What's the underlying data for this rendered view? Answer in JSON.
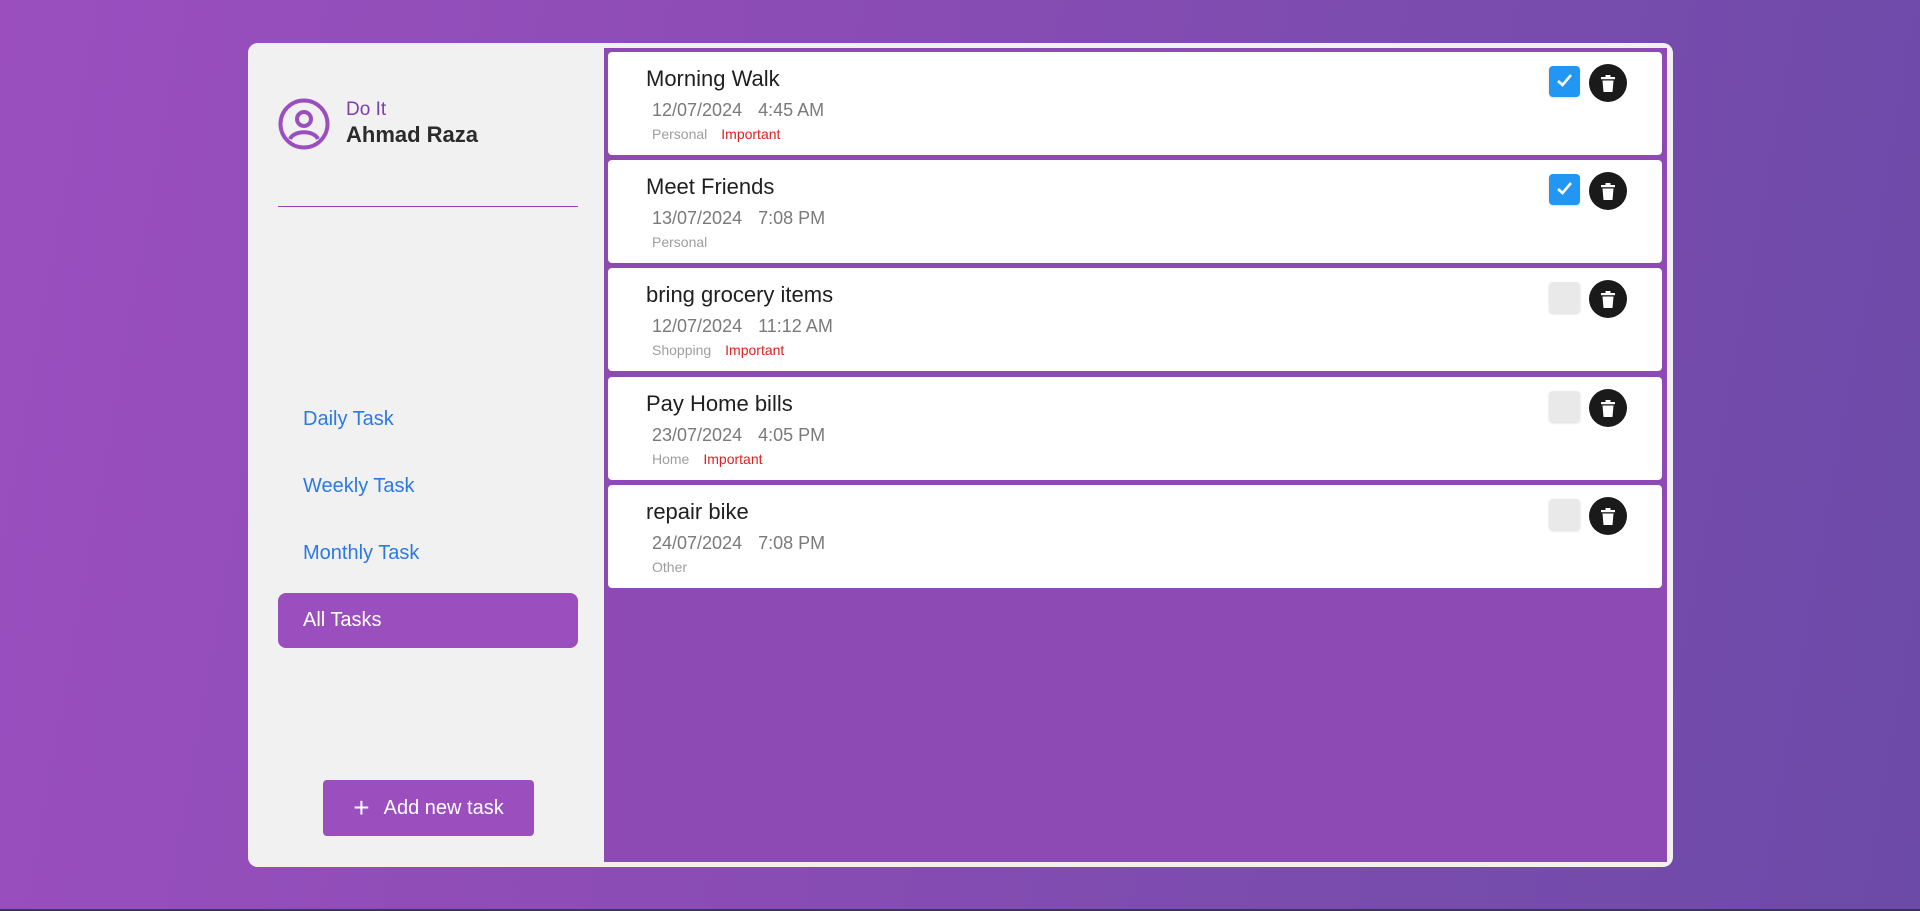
{
  "sidebar": {
    "app_name": "Do It",
    "user_name": "Ahmad Raza",
    "nav": [
      {
        "label": "Daily Task",
        "active": false
      },
      {
        "label": "Weekly Task",
        "active": false
      },
      {
        "label": "Monthly Task",
        "active": false
      },
      {
        "label": "All Tasks",
        "active": true
      }
    ],
    "add_button_label": "Add new task"
  },
  "tasks": [
    {
      "title": "Morning Walk",
      "date": "12/07/2024",
      "time": "4:45 AM",
      "category": "Personal",
      "important": "Important",
      "completed": true
    },
    {
      "title": "Meet Friends",
      "date": "13/07/2024",
      "time": "7:08 PM",
      "category": "Personal",
      "important": "",
      "completed": true
    },
    {
      "title": "bring grocery items",
      "date": "12/07/2024",
      "time": "11:12 AM",
      "category": "Shopping",
      "important": "Important",
      "completed": false
    },
    {
      "title": "Pay Home bills",
      "date": "23/07/2024",
      "time": "4:05 PM",
      "category": "Home",
      "important": "Important",
      "completed": false
    },
    {
      "title": "repair bike",
      "date": "24/07/2024",
      "time": "7:08 PM",
      "category": "Other",
      "important": "",
      "completed": false
    }
  ],
  "colors": {
    "accent": "#9b4fbf",
    "link": "#2a7ae2",
    "checkbox_checked": "#2196f3",
    "important": "#e02020"
  },
  "icons": {
    "avatar": "user-circle-icon",
    "add": "plus-icon",
    "check": "check-icon",
    "delete": "trash-icon"
  }
}
